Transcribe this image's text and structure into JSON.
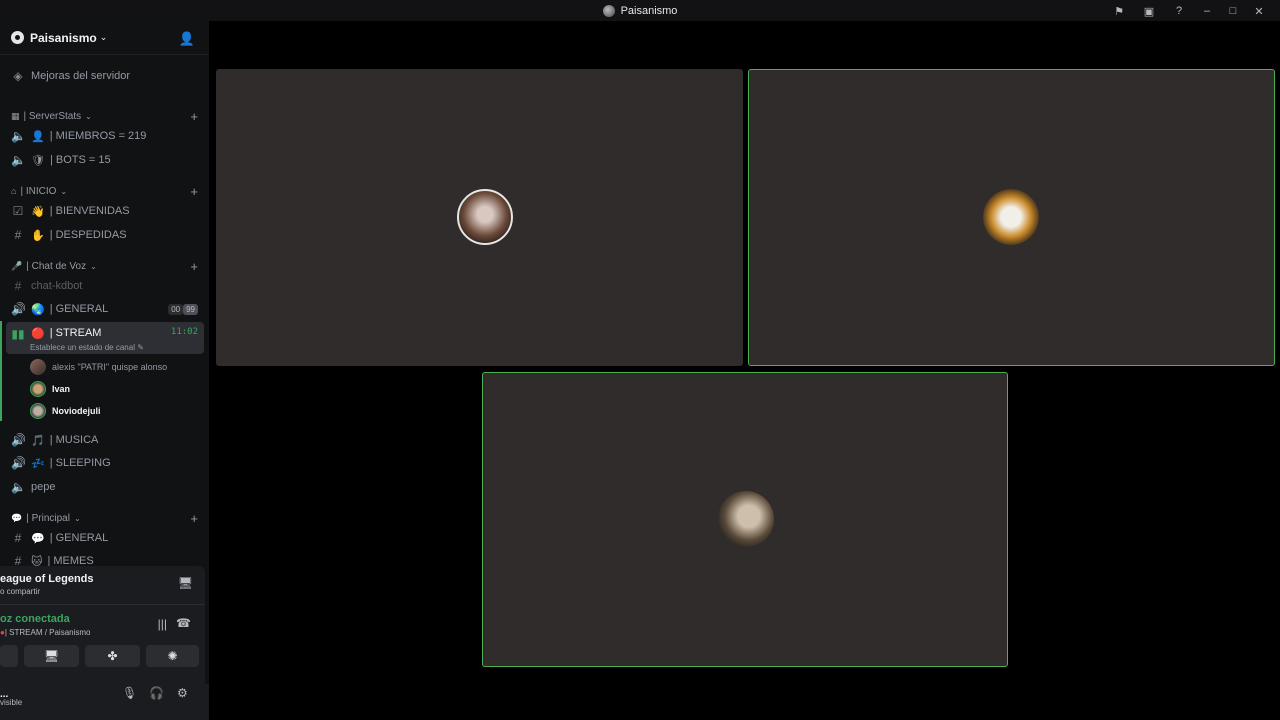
{
  "window": {
    "title": "Paisanismo"
  },
  "titlebar_icons": [
    "flag-icon",
    "inbox-icon",
    "help-icon",
    "minimize-icon",
    "maximize-icon",
    "close-icon"
  ],
  "server": {
    "name": "Paisanismo"
  },
  "channels": {
    "boosts": "Mejoras del servidor",
    "cat_serverstats": "| ServerStats",
    "members": "| MIEMBROS = 219",
    "bots": "| BOTS = 15",
    "cat_inicio": "| INICIO",
    "bienvenidas": "| BIENVENIDAS",
    "despedidas": "| DESPEDIDAS",
    "cat_voz": "| Chat de Voz",
    "chat_kdbot": "chat-kdbot",
    "general_voice": "| GENERAL",
    "general_pills": [
      "00",
      "99"
    ],
    "stream": "| STREAM",
    "stream_time": "11:02",
    "stream_status": "Establece un estado de canal",
    "musica": "| MUSICA",
    "sleeping": "| SLEEPING",
    "pepe": "pepe",
    "cat_principal": "| Principal",
    "general_text": "| GENERAL",
    "memes": "| MEMES"
  },
  "voice_users": [
    {
      "name": "alexis \"PATRI\" quispe alonso"
    },
    {
      "name": "Ivan"
    },
    {
      "name": "Noviodejuli"
    }
  ],
  "activity": {
    "title": "eague of Legends",
    "subtitle": "o compartir"
  },
  "voice": {
    "status": "oz conectada",
    "channel": "| STREAM / Paisanismo"
  },
  "user": {
    "name": "...",
    "status": "visible"
  },
  "colors": {
    "accent_green": "#3ba55d",
    "tile_bg": "#2f2c2b",
    "speaking_border": "#4caf50"
  }
}
